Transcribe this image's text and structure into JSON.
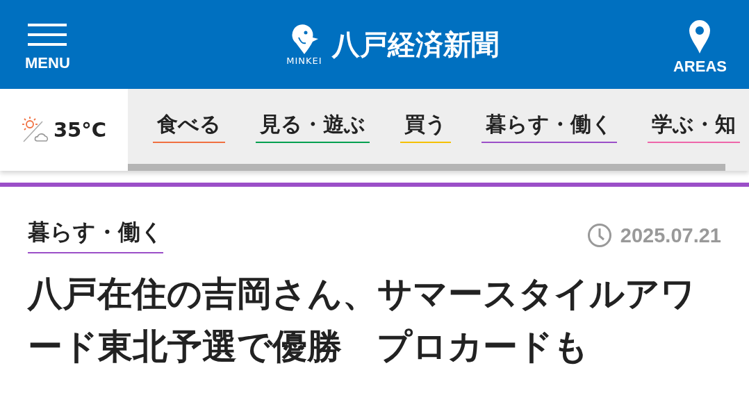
{
  "header": {
    "menu_label": "MENU",
    "logo_sub": "MINKEI",
    "site_title": "八戸経済新聞",
    "areas_label": "AREAS"
  },
  "weather": {
    "temperature": "35°C"
  },
  "nav": [
    {
      "label": "食べる",
      "color": "#f07040"
    },
    {
      "label": "見る・遊ぶ",
      "color": "#00a050"
    },
    {
      "label": "買う",
      "color": "#f5c000"
    },
    {
      "label": "暮らす・働く",
      "color": "#9b4fc8"
    },
    {
      "label": "学ぶ・知",
      "color": "#ee66aa"
    }
  ],
  "article": {
    "category": {
      "label": "暮らす・働く",
      "color": "#9b4fc8"
    },
    "date": "2025.07.21",
    "title": "八戸在住の吉岡さん、サマースタイルアワード東北予選で優勝　プロカードも"
  }
}
